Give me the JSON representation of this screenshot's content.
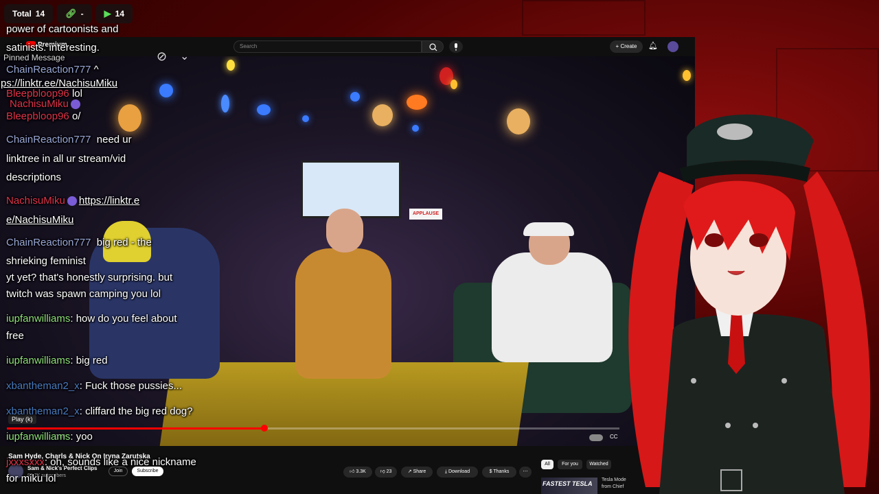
{
  "stats": {
    "total_label": "Total",
    "total_value": "14",
    "link_value": "-",
    "play_value": "14"
  },
  "youtube": {
    "logo_text": "Premium",
    "search_placeholder": "Search",
    "create_label": "Create",
    "play_tooltip": "Play (k)",
    "time_text": "0:09",
    "progress_fraction": 0.42,
    "buffer_fraction": 0.58,
    "video_title": "Sam Hyde, Charls & Nick On Iryna Zarutska",
    "channel_name": "Sam & Nick's Perfect Clips",
    "channel_subs": "99.7K subscribers",
    "join_label": "Join",
    "subscribe_label": "Subscribe",
    "likes": "3.3K",
    "dislikes": "23",
    "share_label": "Share",
    "download_label": "Download",
    "thanks_label": "Thanks",
    "chips": [
      "All",
      "For you",
      "Watched"
    ],
    "rec_thumb_text": "FASTEST TESLA",
    "rec_title_1": "Tesla Mode",
    "rec_title_2": "from Chief",
    "applause_sign": "APPLAUSE"
  },
  "chat": {
    "l01": "power of cartoonists and",
    "l02": "satinists. interesting.",
    "pinned": "Pinned Message",
    "l03_user": "ChainReaction777",
    "l03_text": "^",
    "l04": "ps://linktr.ee/NachisuMiku",
    "l05_user": "Bleepbloop96",
    "l05_text": "lol",
    "l06_user": "NachisuMiku",
    "l07_user": "Bleepbloop96",
    "l07_text": "o/",
    "l08_user": "ChainReaction777",
    "l08_text": "need ur",
    "l09": "linktree in all ur stream/vid",
    "l10": "descriptions",
    "l11_user": "NachisuMiku",
    "l11_link": "https://linktr.e",
    "l12": "e/NachisuMiku",
    "l13_user": "ChainReaction777",
    "l13_text": "big red - the",
    "l14": "shrieking feminist",
    "l15": "yt yet? that's honestly surprising. but",
    "l16": "twitch was spawn camping you lol",
    "l17_user": "iupfanwilliams",
    "l17_text": ": how do you feel about",
    "l18": "free",
    "l19_user": "iupfanwilliams",
    "l19_text": ": big red",
    "l20_user": "xbantheman2_x",
    "l20_text": ": Fuck those pussies...",
    "l21_user": "xbantheman2_x",
    "l21_text": ": cliffard the big red dog?",
    "l22_user": "iupfanwilliams",
    "l22_text": ": yoo",
    "l23_user": "jxxxsxxx",
    "l23_text": ": oh, sounds like a nice nickname",
    "l24": "for miku lol"
  },
  "colors": {
    "accent_red": "#ff0000",
    "chat_blue": "#9aa8d6",
    "chat_red": "#e0334a",
    "chat_green": "#8fe07a",
    "chat_teal": "#4a7bbf"
  }
}
